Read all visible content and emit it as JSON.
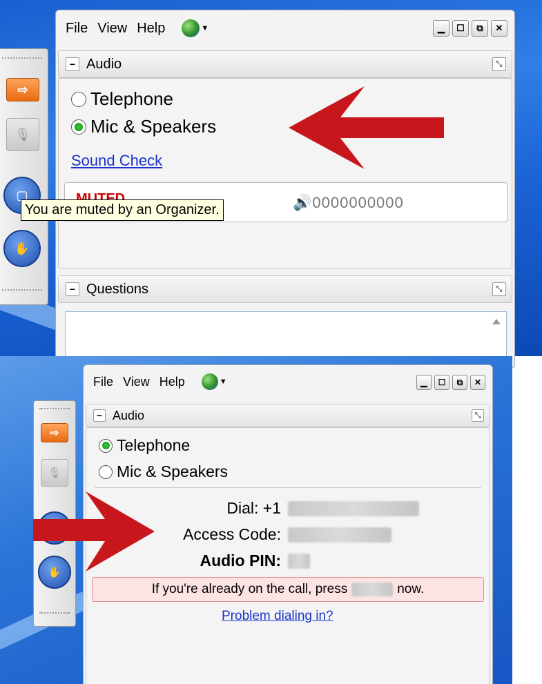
{
  "top": {
    "menu": [
      "File",
      "View",
      "Help"
    ],
    "audio_title": "Audio",
    "options": [
      {
        "label": "Telephone",
        "selected": false
      },
      {
        "label": "Mic & Speakers",
        "selected": true
      }
    ],
    "sound_check": "Sound Check",
    "muted_label": "MUTED",
    "level_text": "0000000000",
    "tooltip": "You are muted by an Organizer.",
    "questions_title": "Questions"
  },
  "bottom": {
    "menu": [
      "File",
      "View",
      "Help"
    ],
    "audio_title": "Audio",
    "options": [
      {
        "label": "Telephone",
        "selected": true
      },
      {
        "label": "Mic & Speakers",
        "selected": false
      }
    ],
    "dial_label": "Dial:",
    "dial_prefix": "+1",
    "access_code_label": "Access Code:",
    "audio_pin_label": "Audio PIN:",
    "notice_before": "If you're already on the call, press",
    "notice_after": "now.",
    "problem_link": "Problem dialing in?"
  },
  "colors": {
    "arrow": "#c8161d",
    "link": "#1a33cc",
    "muted": "#d00000",
    "tooltip_bg": "#ffffe1",
    "notice_bg": "#fde4e4"
  },
  "icons": {
    "dock": [
      "exit-arrow-icon",
      "microphone-icon",
      "screen-icon",
      "raise-hand-icon"
    ],
    "window": [
      "minimize-icon",
      "maximize-icon",
      "popout-icon",
      "close-icon"
    ]
  }
}
